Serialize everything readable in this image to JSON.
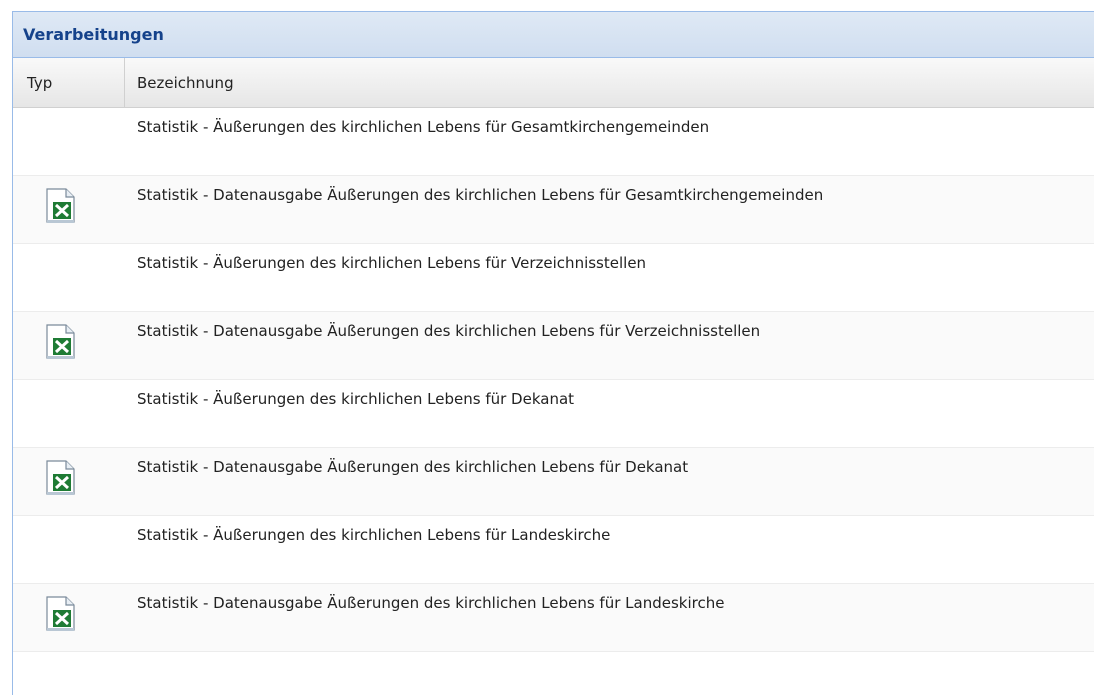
{
  "panel": {
    "title": "Verarbeitungen"
  },
  "grid": {
    "columns": [
      "Typ",
      "Bezeichnung"
    ],
    "rows": [
      {
        "icon": "",
        "label": "Statistik - Äußerungen des kirchlichen Lebens für Gesamtkirchengemeinden"
      },
      {
        "icon": "excel-file-icon",
        "label": "Statistik - Datenausgabe Äußerungen des kirchlichen Lebens für Gesamtkirchengemeinden"
      },
      {
        "icon": "",
        "label": "Statistik - Äußerungen des kirchlichen Lebens für Verzeichnisstellen"
      },
      {
        "icon": "excel-file-icon",
        "label": "Statistik - Datenausgabe Äußerungen des kirchlichen Lebens für Verzeichnisstellen"
      },
      {
        "icon": "",
        "label": "Statistik - Äußerungen des kirchlichen Lebens für Dekanat"
      },
      {
        "icon": "excel-file-icon",
        "label": "Statistik - Datenausgabe Äußerungen des kirchlichen Lebens für Dekanat"
      },
      {
        "icon": "",
        "label": "Statistik - Äußerungen des kirchlichen Lebens für Landeskirche"
      },
      {
        "icon": "excel-file-icon",
        "label": "Statistik - Datenausgabe Äußerungen des kirchlichen Lebens für Landeskirche"
      }
    ]
  },
  "colors": {
    "header_title": "#15428b",
    "panel_border": "#99bbe8",
    "excel_green": "#1e7b34"
  }
}
